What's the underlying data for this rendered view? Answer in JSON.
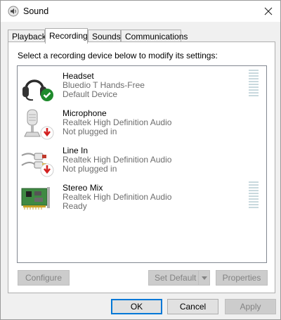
{
  "window": {
    "title": "Sound"
  },
  "tabs": [
    {
      "label": "Playback"
    },
    {
      "label": "Recording"
    },
    {
      "label": "Sounds"
    },
    {
      "label": "Communications"
    }
  ],
  "instructions": "Select a recording device below to modify its settings:",
  "devices": [
    {
      "name": "Headset",
      "description": "Bluedio T Hands-Free",
      "status": "Default Device",
      "icon": "headset-icon",
      "badge": "default-check-icon"
    },
    {
      "name": "Microphone",
      "description": "Realtek High Definition Audio",
      "status": "Not plugged in",
      "icon": "microphone-icon",
      "badge": "unplugged-arrow-icon"
    },
    {
      "name": "Line In",
      "description": "Realtek High Definition Audio",
      "status": "Not plugged in",
      "icon": "line-in-icon",
      "badge": "unplugged-arrow-icon"
    },
    {
      "name": "Stereo Mix",
      "description": "Realtek High Definition Audio",
      "status": "Ready",
      "icon": "sound-card-icon",
      "badge": null
    }
  ],
  "buttons": {
    "configure": "Configure",
    "set_default": "Set Default",
    "properties": "Properties",
    "ok": "OK",
    "cancel": "Cancel",
    "apply": "Apply"
  },
  "colors": {
    "accent": "#0078d7",
    "check_badge": "#1e8a2c",
    "unplugged_badge": "#d32020",
    "meter": "#c9d9de"
  }
}
